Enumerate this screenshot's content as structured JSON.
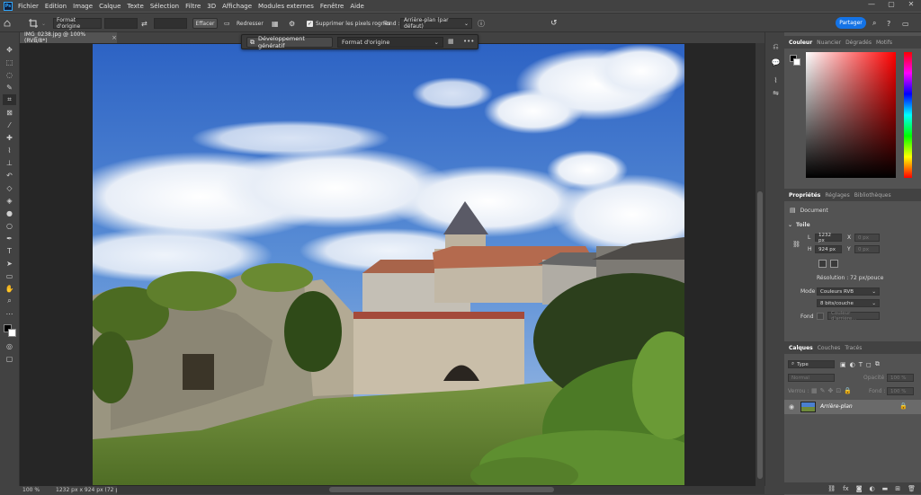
{
  "app": {
    "logo": "Ps"
  },
  "menu": [
    "Fichier",
    "Edition",
    "Image",
    "Calque",
    "Texte",
    "Sélection",
    "Filtre",
    "3D",
    "Affichage",
    "Modules externes",
    "Fenêtre",
    "Aide"
  ],
  "window_controls": {
    "minimize": "—",
    "maximize": "▢",
    "close": "✕"
  },
  "options": {
    "ratio_select": "Format d'origine",
    "clear_label": "Effacer",
    "straighten_label": "Redresser",
    "delete_pixels_label": "Supprimer les pixels rognés",
    "fill_label": "Fond :",
    "fill_select": "Arrière-plan (par défaut)",
    "share_label": "Partager"
  },
  "document": {
    "tab_title": "IMG_0238.jpg @ 100% (RVB/8*)",
    "close": "×"
  },
  "context_bar": {
    "generative_label": "Développement génératif",
    "format_select": "Format d'origine",
    "more": "•••"
  },
  "status": {
    "zoom": "100 %",
    "doc_size": "1232 px x 924 px (72 ppp)",
    "arrow": "›"
  },
  "color_panel": {
    "tabs": [
      "Couleur",
      "Nuancier",
      "Dégradés",
      "Motifs"
    ],
    "hue": "#ff0000"
  },
  "properties": {
    "tabs": [
      "Propriétés",
      "Réglages",
      "Bibliothèques"
    ],
    "doc_label": "Document",
    "section": "Toile",
    "w_label": "L",
    "w_value": "1232 px",
    "x_label": "X",
    "x_value": "0 px",
    "h_label": "H",
    "h_value": "924 px",
    "y_label": "Y",
    "y_value": "0 px",
    "resolution": "Résolution : 72 px/pouce",
    "mode_label": "Mode",
    "mode_value": "Couleurs RVB",
    "depth_value": "8 bits/couche",
    "bg_label": "Fond",
    "bg_value": "Couleur d'arrière..."
  },
  "layers": {
    "tabs": [
      "Calques",
      "Couches",
      "Tracés"
    ],
    "filter_placeholder": "Type",
    "blend_mode": "Normal",
    "opacity_label": "Opacité :",
    "opacity_value": "100 %",
    "lock_label": "Verrou :",
    "fill_label": "Fond :",
    "fill_value": "100 %",
    "items": [
      {
        "name": "Arrière-plan"
      }
    ],
    "footer_icons": [
      "link-icon",
      "fx-icon",
      "mask-icon",
      "adjustment-icon",
      "group-icon",
      "new-layer-icon",
      "trash-icon"
    ]
  },
  "colors": {
    "accent": "#1473e6",
    "sky": "#4a7fcf",
    "grass": "#6f8a3a",
    "stone": "#b5ad9c",
    "roof": "#a8644a"
  }
}
